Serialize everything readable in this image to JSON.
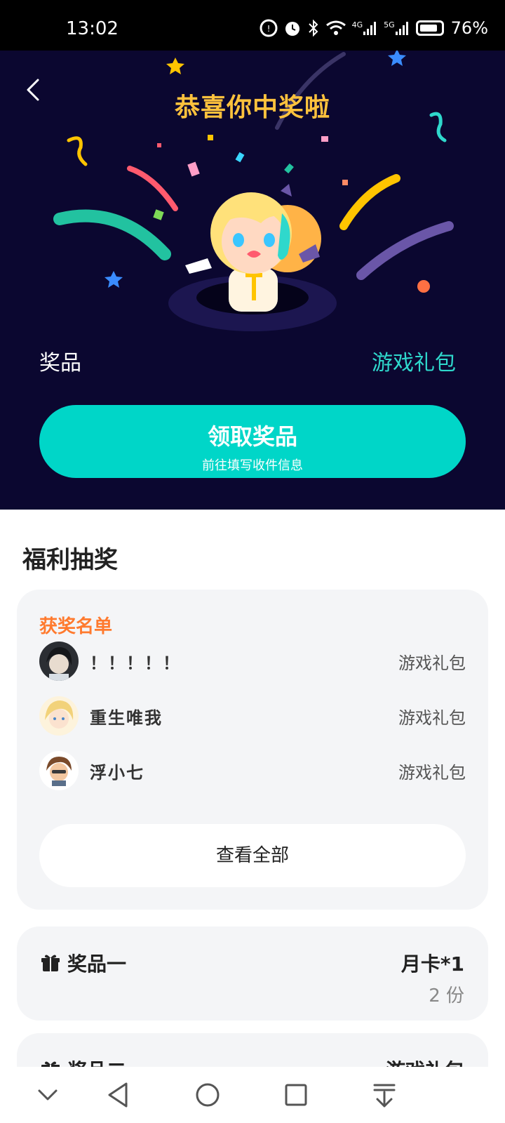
{
  "status_bar": {
    "time": "13:02",
    "icons": [
      "data-saver-icon",
      "alarm-icon",
      "bluetooth-icon",
      "wifi-icon",
      "signal-4g-icon",
      "signal-5g-icon",
      "battery-icon"
    ],
    "network_1": "4G",
    "network_2": "5G",
    "battery": "76%"
  },
  "hero": {
    "title": "恭喜你中奖啦",
    "prize_label": "奖品",
    "prize_value": "游戏礼包",
    "claim_button": {
      "label": "领取奖品",
      "sublabel": "前往填写收件信息"
    },
    "colors": {
      "background": "#0b0730",
      "title": "#ffc23d",
      "accent": "#00d6c8"
    }
  },
  "lottery": {
    "section_title": "福利抽奖",
    "winners": {
      "heading": "获奖名单",
      "rows": [
        {
          "name": "！！！！！",
          "prize": "游戏礼包"
        },
        {
          "name": "重生唯我",
          "prize": "游戏礼包"
        },
        {
          "name": "浮小七",
          "prize": "游戏礼包"
        }
      ],
      "view_all": "查看全部"
    },
    "prizes": [
      {
        "name": "奖品一",
        "item": "月卡*1",
        "quantity": "2 份"
      },
      {
        "name": "奖品二",
        "item": "游戏礼包",
        "quantity": ""
      }
    ]
  },
  "nav_bar": {
    "buttons": [
      "collapse-icon",
      "back-icon",
      "home-icon",
      "recents-icon",
      "pull-down-icon"
    ]
  }
}
